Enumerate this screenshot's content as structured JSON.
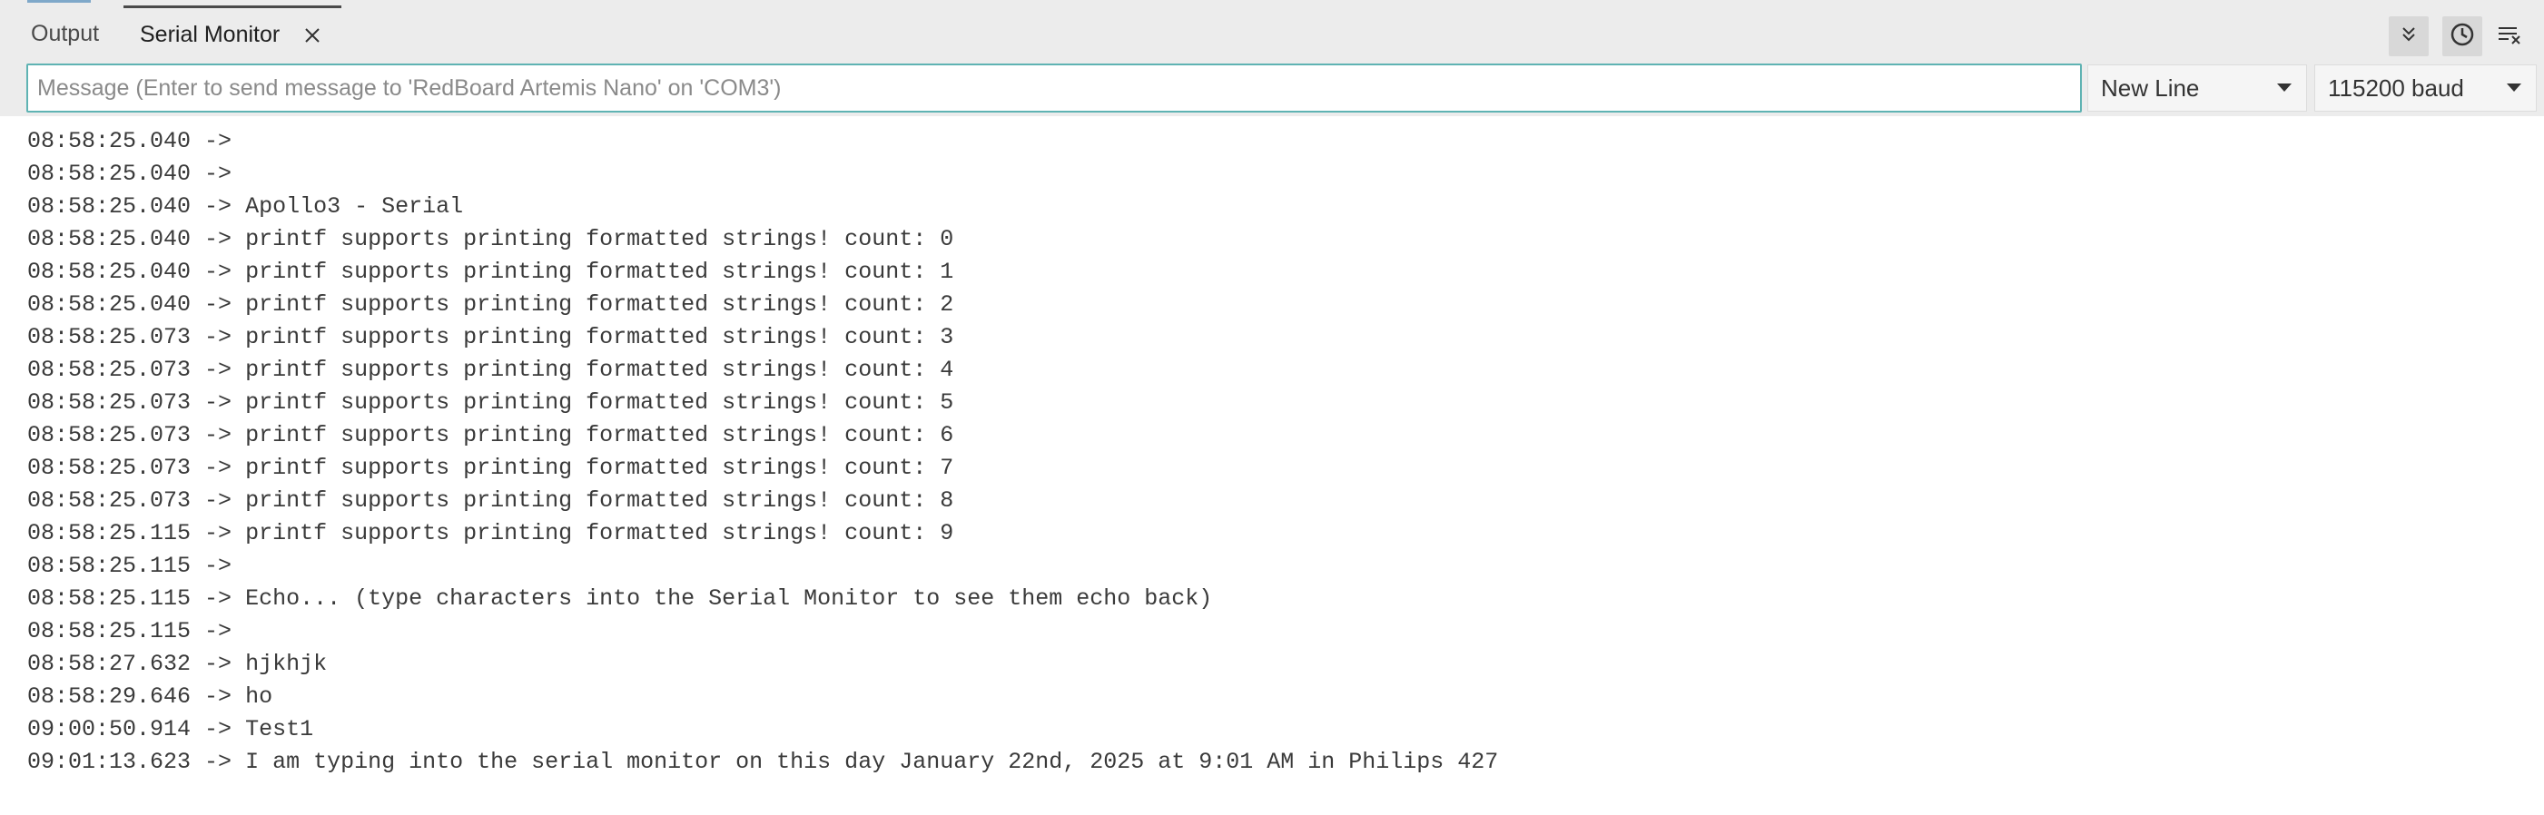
{
  "tabs": {
    "output_label": "Output",
    "serial_label": "Serial Monitor"
  },
  "toolbar": {
    "autoscroll_icon": "chevrons-down-icon",
    "timestamp_icon": "clock-icon",
    "clear_icon": "clear-output-icon"
  },
  "message": {
    "placeholder": "Message (Enter to send message to 'RedBoard Artemis Nano' on 'COM3')",
    "value": ""
  },
  "line_ending": {
    "selected": "New Line"
  },
  "baud": {
    "selected": "115200 baud"
  },
  "log": [
    {
      "time": "08:58:25.040",
      "arrow": "->",
      "text": ""
    },
    {
      "time": "08:58:25.040",
      "arrow": "->",
      "text": ""
    },
    {
      "time": "08:58:25.040",
      "arrow": "->",
      "text": "Apollo3 - Serial"
    },
    {
      "time": "08:58:25.040",
      "arrow": "->",
      "text": "printf supports printing formatted strings! count: 0"
    },
    {
      "time": "08:58:25.040",
      "arrow": "->",
      "text": "printf supports printing formatted strings! count: 1"
    },
    {
      "time": "08:58:25.040",
      "arrow": "->",
      "text": "printf supports printing formatted strings! count: 2"
    },
    {
      "time": "08:58:25.073",
      "arrow": "->",
      "text": "printf supports printing formatted strings! count: 3"
    },
    {
      "time": "08:58:25.073",
      "arrow": "->",
      "text": "printf supports printing formatted strings! count: 4"
    },
    {
      "time": "08:58:25.073",
      "arrow": "->",
      "text": "printf supports printing formatted strings! count: 5"
    },
    {
      "time": "08:58:25.073",
      "arrow": "->",
      "text": "printf supports printing formatted strings! count: 6"
    },
    {
      "time": "08:58:25.073",
      "arrow": "->",
      "text": "printf supports printing formatted strings! count: 7"
    },
    {
      "time": "08:58:25.073",
      "arrow": "->",
      "text": "printf supports printing formatted strings! count: 8"
    },
    {
      "time": "08:58:25.115",
      "arrow": "->",
      "text": "printf supports printing formatted strings! count: 9"
    },
    {
      "time": "08:58:25.115",
      "arrow": "->",
      "text": ""
    },
    {
      "time": "08:58:25.115",
      "arrow": "->",
      "text": "Echo... (type characters into the Serial Monitor to see them echo back)"
    },
    {
      "time": "08:58:25.115",
      "arrow": "->",
      "text": ""
    },
    {
      "time": "08:58:27.632",
      "arrow": "->",
      "text": "hjkhjk"
    },
    {
      "time": "08:58:29.646",
      "arrow": "->",
      "text": "ho"
    },
    {
      "time": "09:00:50.914",
      "arrow": "->",
      "text": "Test1"
    },
    {
      "time": "09:01:13.623",
      "arrow": "->",
      "text": "I am typing into the serial monitor on this day January 22nd, 2025 at 9:01 AM in Philips 427"
    }
  ]
}
